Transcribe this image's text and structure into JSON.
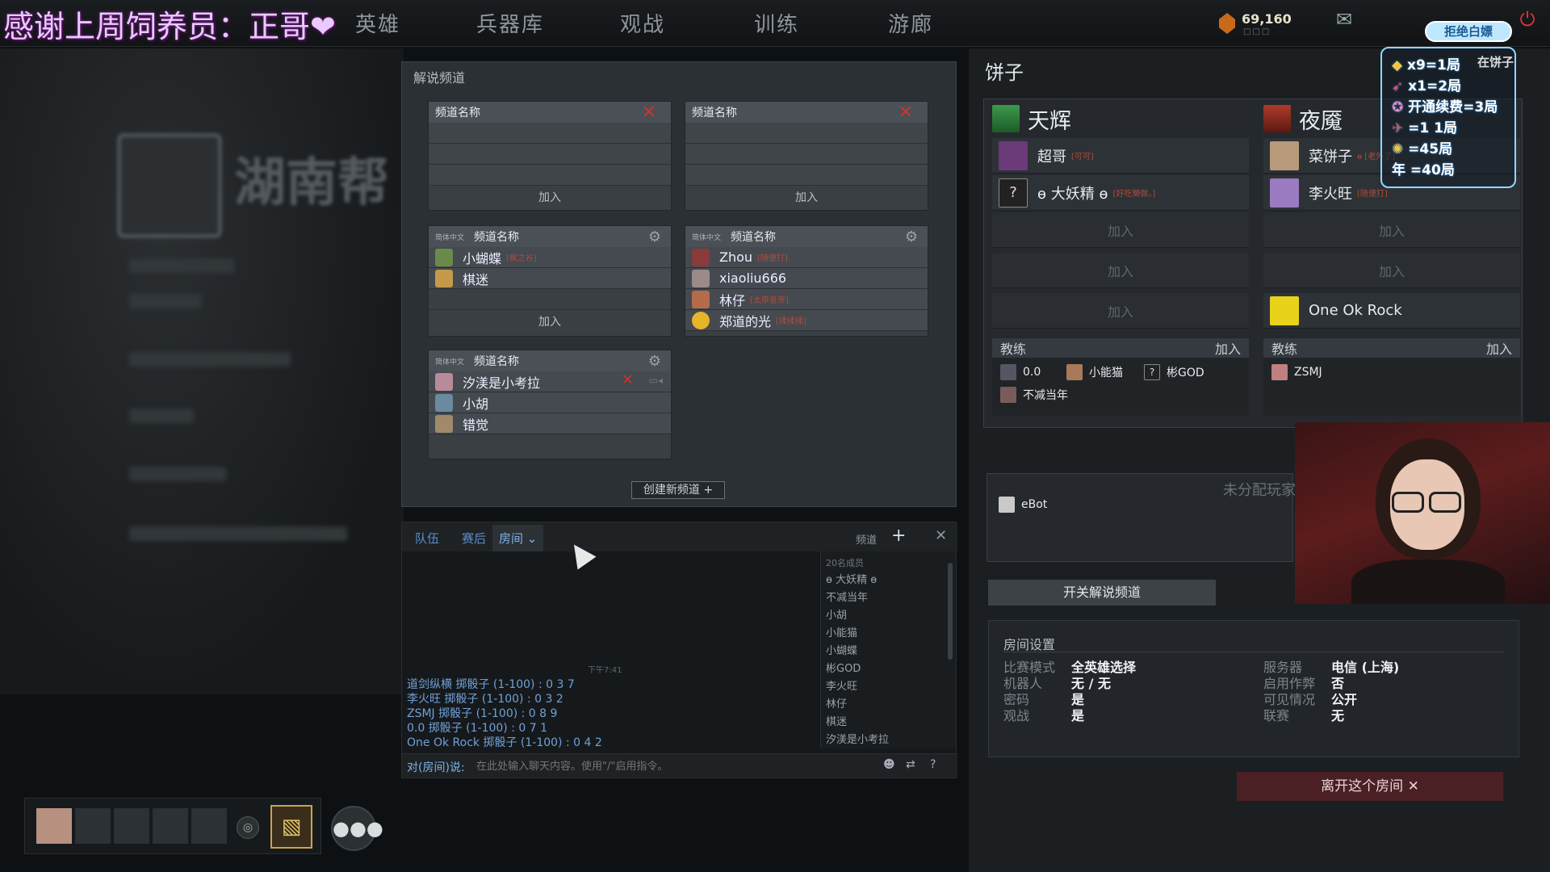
{
  "overlay_banner": {
    "donation": "感谢上周饲养员：正哥❤"
  },
  "nav": {
    "tabs": [
      "英雄",
      "兵器库",
      "观战",
      "训练",
      "游廊"
    ]
  },
  "currency": {
    "amount": "69,160"
  },
  "stream_overlay": {
    "badge": "拒绝白嫖",
    "lines": [
      "x9=1局",
      "x1=2局",
      "开通续费=3局",
      "=1 1局",
      "=45局",
      "年 =40局"
    ],
    "partial_text": "在饼子"
  },
  "commentary": {
    "title": "解说频道",
    "channels": [
      {
        "lang": "",
        "name": "频道名称",
        "members": [],
        "join": "加入",
        "closable": true
      },
      {
        "lang": "",
        "name": "频道名称",
        "members": [],
        "join": "加入",
        "closable": true
      },
      {
        "lang": "简体中文",
        "name": "频道名称",
        "members": [
          {
            "name": "小蝴蝶",
            "tag": "[枫之谷]"
          },
          {
            "name": "棋迷",
            "tag": ""
          }
        ],
        "join": "加入"
      },
      {
        "lang": "简体中文",
        "name": "频道名称",
        "members": [
          {
            "name": "Zhou",
            "tag": "[随便打]"
          },
          {
            "name": "xiaoliu666",
            "tag": ""
          },
          {
            "name": "林仔",
            "tag": "[太原皇帝]"
          },
          {
            "name": "郑道的光",
            "tag": "[揉揉揉]"
          }
        ]
      },
      {
        "lang": "简体中文",
        "name": "频道名称",
        "members": [
          {
            "name": "汐渼是小考拉",
            "tag": ""
          },
          {
            "name": "小胡",
            "tag": ""
          },
          {
            "name": "错觉",
            "tag": ""
          }
        ]
      }
    ],
    "create_label": "创建新频道 +"
  },
  "chat": {
    "tabs": [
      "队伍",
      "赛后",
      "房间 ⌄"
    ],
    "channel_label": "频道",
    "member_count": "20名成员",
    "members": [
      "ɵ 大妖精 ɵ",
      "不减当年",
      "小胡",
      "小能猫",
      "小蝴蝶",
      "彬GOD",
      "李火旺",
      "林仔",
      "棋迷",
      "汐渼是小考拉"
    ],
    "timestamp": "下午7:41",
    "log": [
      "道剑纵横 掷骰子 (1-100) :  0 3 7",
      "李火旺 掷骰子 (1-100) :  0 3 2",
      "ZSMJ 掷骰子 (1-100) :  0 8 9",
      "0.0 掷骰子 (1-100) :  0 7 1",
      "One Ok Rock 掷骰子 (1-100) :  0 4 2"
    ],
    "input_prefix": "对(房间)说:",
    "input_placeholder": "在此处输入聊天内容。使用\"/\"启用指令。"
  },
  "room": {
    "title": "饼子",
    "radiant": {
      "name": "天辉",
      "players": [
        {
          "name": "超哥",
          "tag": "[可可]"
        },
        {
          "name": "ɵ 大妖精 ɵ",
          "tag": "[好吃懒做。]"
        }
      ],
      "join": "加入",
      "coach_label": "教练",
      "coaches": [
        "0.0",
        "小能猫",
        "彬GOD",
        "不减当年"
      ]
    },
    "dire": {
      "name": "夜魇",
      "players": [
        {
          "name": "菜饼子",
          "tag": "ɵ [老外了]"
        },
        {
          "name": "李火旺",
          "tag": "[随便打]"
        }
      ],
      "extra_player": "One Ok Rock",
      "join": "加入",
      "coach_label": "教练",
      "coaches": [
        "ZSMJ"
      ]
    },
    "unassigned_label": "未分配玩家",
    "unassigned": [
      "eBot"
    ],
    "toggle_commentary": "开关解说频道",
    "settings": {
      "title": "房间设置",
      "left": [
        [
          "比赛模式",
          "全英雄选择"
        ],
        [
          "机器人",
          "无 / 无"
        ],
        [
          "密码",
          "是"
        ],
        [
          "观战",
          "是"
        ]
      ],
      "right": [
        [
          "服务器",
          "电信 (上海)"
        ],
        [
          "启用作弊",
          "否"
        ],
        [
          "可见情况",
          "公开"
        ],
        [
          "联赛",
          "无"
        ]
      ]
    },
    "leave": "离开这个房间 ✕"
  },
  "colors": {
    "accent_blue": "#5b8ec7",
    "close_red": "#cc3333",
    "tag_red": "#b04a3a"
  }
}
